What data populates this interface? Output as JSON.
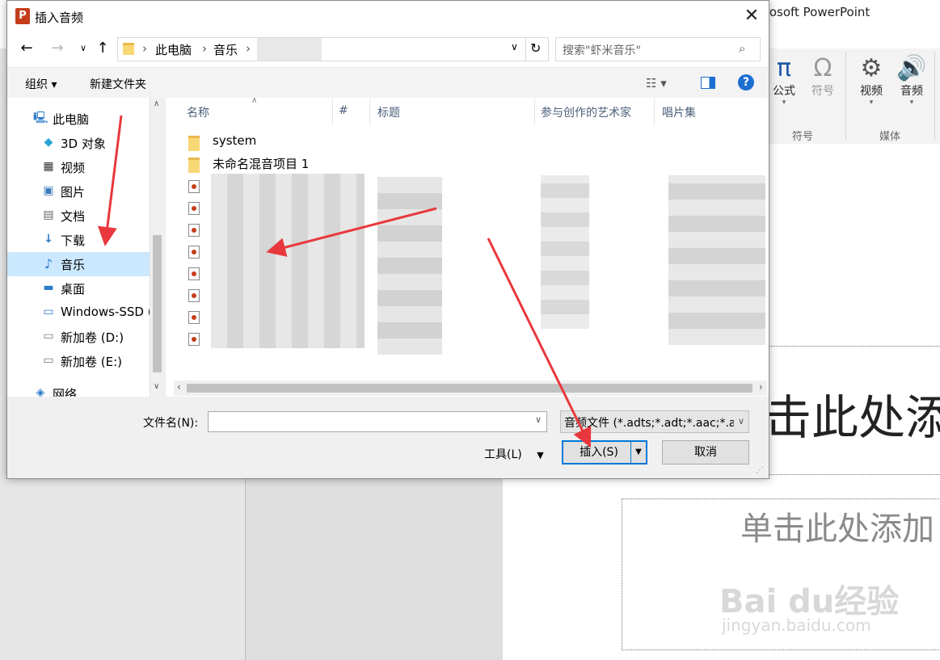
{
  "powerpoint": {
    "window_title": "rosoft PowerPoint",
    "ribbon": {
      "equation_label": "公式",
      "symbol_label": "符号",
      "symbols_group": "符号",
      "video_label": "视频",
      "audio_label": "音频",
      "media_group": "媒体"
    },
    "slide": {
      "title_placeholder": "击此处添",
      "subtitle_placeholder": "单击此处添加"
    },
    "watermark": {
      "text": "Bai du经验",
      "url": "jingyan.baidu.com"
    }
  },
  "dialog": {
    "title": "插入音频",
    "address": {
      "segments": [
        "此电脑",
        "音乐"
      ]
    },
    "search": {
      "placeholder": "搜索\"虾米音乐\""
    },
    "toolbar": {
      "organize": "组织 ▾",
      "new_folder": "新建文件夹"
    },
    "nav": {
      "items": [
        {
          "label": "此电脑",
          "icon": "computer-icon",
          "indent": 0
        },
        {
          "label": "3D 对象",
          "icon": "cube-icon",
          "indent": 1
        },
        {
          "label": "视频",
          "icon": "film-icon",
          "indent": 1
        },
        {
          "label": "图片",
          "icon": "image-icon",
          "indent": 1
        },
        {
          "label": "文档",
          "icon": "document-icon",
          "indent": 1
        },
        {
          "label": "下载",
          "icon": "download-icon",
          "indent": 1
        },
        {
          "label": "音乐",
          "icon": "music-icon",
          "indent": 1,
          "selected": true
        },
        {
          "label": "桌面",
          "icon": "desktop-icon",
          "indent": 1
        },
        {
          "label": "Windows-SSD (",
          "icon": "drive-icon",
          "indent": 1
        },
        {
          "label": "新加卷 (D:)",
          "icon": "drive-icon",
          "indent": 1
        },
        {
          "label": "新加卷 (E:)",
          "icon": "drive-icon",
          "indent": 1
        },
        {
          "label": "网络",
          "icon": "network-icon",
          "indent": 0
        }
      ]
    },
    "columns": [
      "名称",
      "#",
      "标题",
      "参与创作的艺术家",
      "唱片集"
    ],
    "files": [
      {
        "name": "system",
        "type": "folder"
      },
      {
        "name": "未命名混音项目 1",
        "type": "folder"
      },
      {
        "name": "",
        "type": "audio"
      },
      {
        "name": "",
        "type": "audio"
      },
      {
        "name": "",
        "type": "audio"
      },
      {
        "name": "",
        "type": "audio"
      },
      {
        "name": "",
        "type": "audio"
      },
      {
        "name": "",
        "type": "audio"
      },
      {
        "name": "",
        "type": "audio"
      },
      {
        "name": "",
        "type": "audio"
      }
    ],
    "filename_label": "文件名(N):",
    "filename_value": "",
    "file_type_filter": "音频文件 (*.adts;*.adt;*.aac;*.a",
    "tools_label": "工具(L)",
    "insert_label": "插入(S)",
    "cancel_label": "取消"
  },
  "colors": {
    "annotation_arrow": "#e8383d",
    "selection": "#cce8ff",
    "primary_border": "#0078d7"
  }
}
